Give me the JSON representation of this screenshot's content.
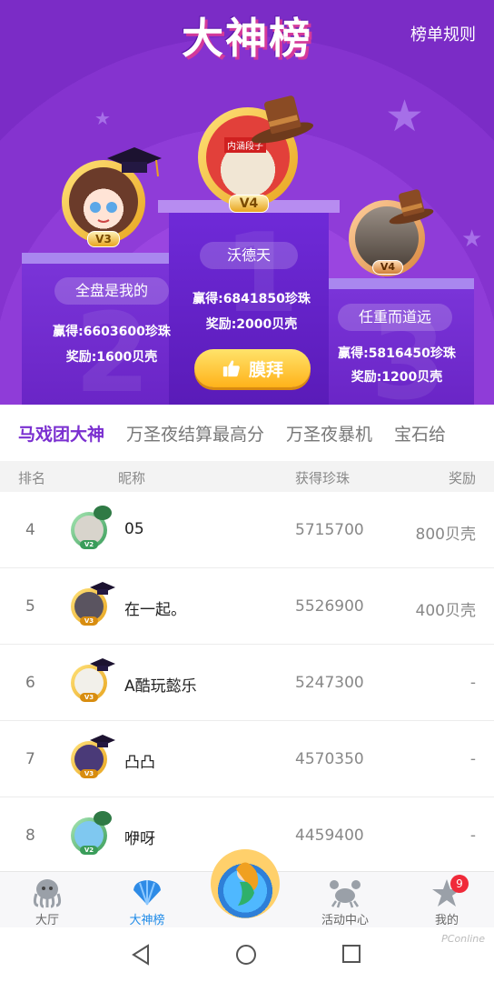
{
  "header": {
    "title": "大神榜",
    "rules_label": "榜单规则"
  },
  "podium": {
    "first": {
      "name": "沃德天",
      "level": "V4",
      "won": "赢得:6841850珍珠",
      "reward": "奖励:2000贝壳",
      "avatar_text": "内涵段子"
    },
    "second": {
      "name": "全盘是我的",
      "level": "V3",
      "won": "赢得:6603600珍珠",
      "reward": "奖励:1600贝壳"
    },
    "third": {
      "name": "任重而道远",
      "level": "V4",
      "won": "赢得:5816450珍珠",
      "reward": "奖励:1200贝壳"
    },
    "worship_label": "膜拜"
  },
  "tabs": [
    "马戏团大神",
    "万圣夜结算最高分",
    "万圣夜暴机",
    "宝石给"
  ],
  "table": {
    "headers": {
      "rank": "排名",
      "nickname": "昵称",
      "pearls": "获得珍珠",
      "reward": "奖励"
    },
    "rows": [
      {
        "rank": "4",
        "nickname": "05",
        "pearls": "5715700",
        "reward": "800贝壳",
        "level": "V2"
      },
      {
        "rank": "5",
        "nickname": "在一起。",
        "pearls": "5526900",
        "reward": "400贝壳",
        "level": "V3"
      },
      {
        "rank": "6",
        "nickname": "A酷玩懿乐",
        "pearls": "5247300",
        "reward": "-",
        "level": "V3"
      },
      {
        "rank": "7",
        "nickname": "凸凸",
        "pearls": "4570350",
        "reward": "-",
        "level": "V3"
      },
      {
        "rank": "8",
        "nickname": "咿呀",
        "pearls": "4459400",
        "reward": "-",
        "level": "V2"
      }
    ]
  },
  "bottom_nav": {
    "items": [
      {
        "label": "大厅",
        "icon": "octopus-icon"
      },
      {
        "label": "大神榜",
        "icon": "shell-icon"
      },
      {
        "label": "活动中心",
        "icon": "crab-icon"
      },
      {
        "label": "我的",
        "icon": "starfish-icon"
      }
    ],
    "badge": "9"
  },
  "watermark": "PConline",
  "colors": {
    "hero_purple": "#8533cf",
    "active_tab": "#7a2fd0",
    "active_nav": "#1f8be8",
    "gold": "#ffb21a"
  }
}
